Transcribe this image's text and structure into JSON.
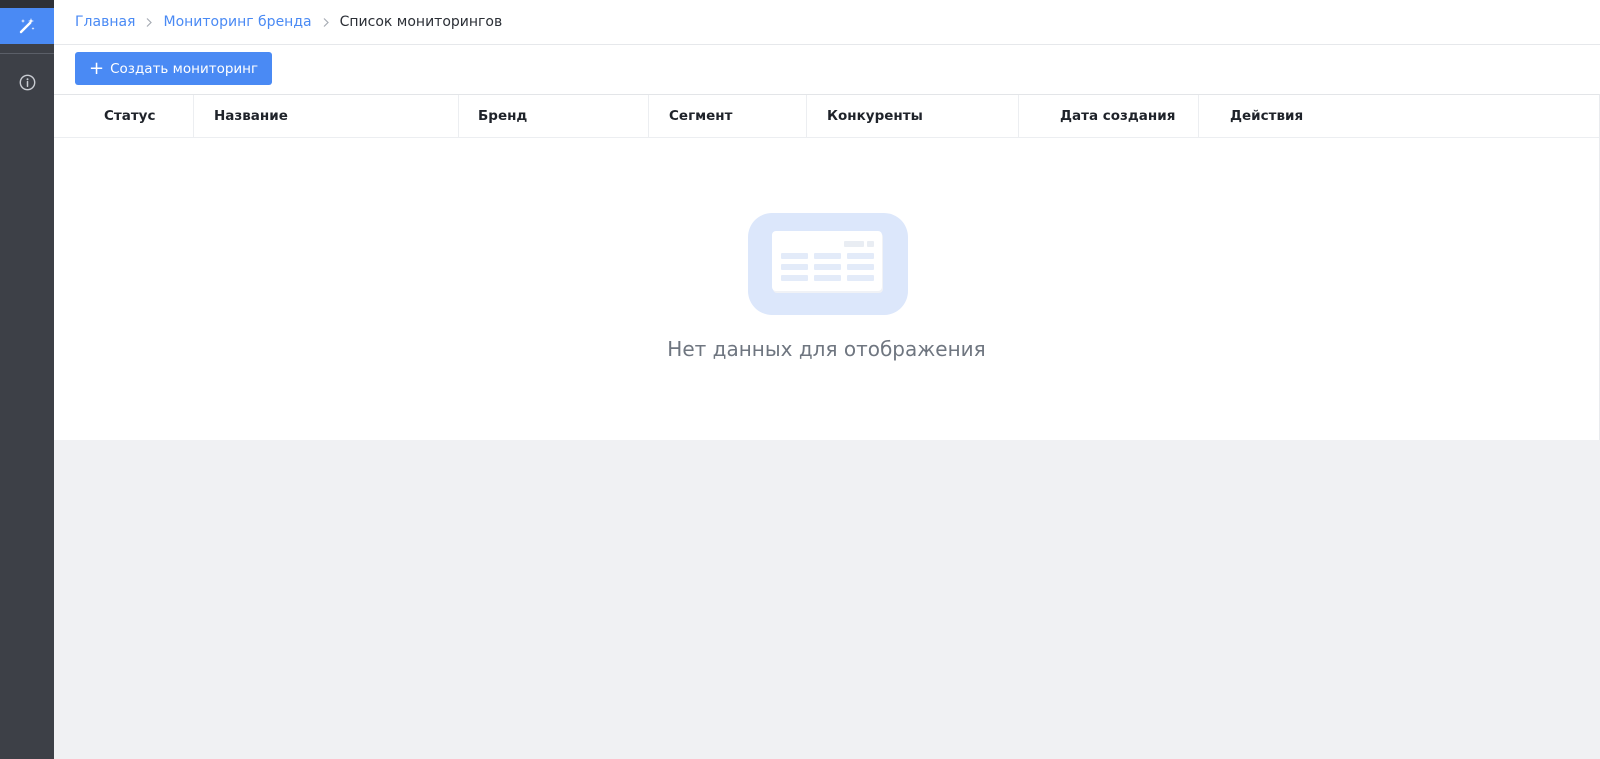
{
  "breadcrumb": {
    "items": [
      "Главная",
      "Мониторинг бренда"
    ],
    "current": "Список мониторингов"
  },
  "toolbar": {
    "create_label": "Создать мониторинг"
  },
  "table": {
    "columns": [
      "Статус",
      "Название",
      "Бренд",
      "Сегмент",
      "Конкуренты",
      "Дата создания",
      "Действия"
    ],
    "rows": [],
    "empty_text": "Нет данных для отображения"
  },
  "icons": {
    "sidebar_active": "magic-wand-icon",
    "sidebar_info": "info-icon",
    "breadcrumb_separator": "chevron-right-icon",
    "create": "plus-icon",
    "empty": "empty-table-icon"
  },
  "colors": {
    "accent": "#4a8af4",
    "sidebar": "#3d4047",
    "page_bg": "#f0f1f3"
  }
}
